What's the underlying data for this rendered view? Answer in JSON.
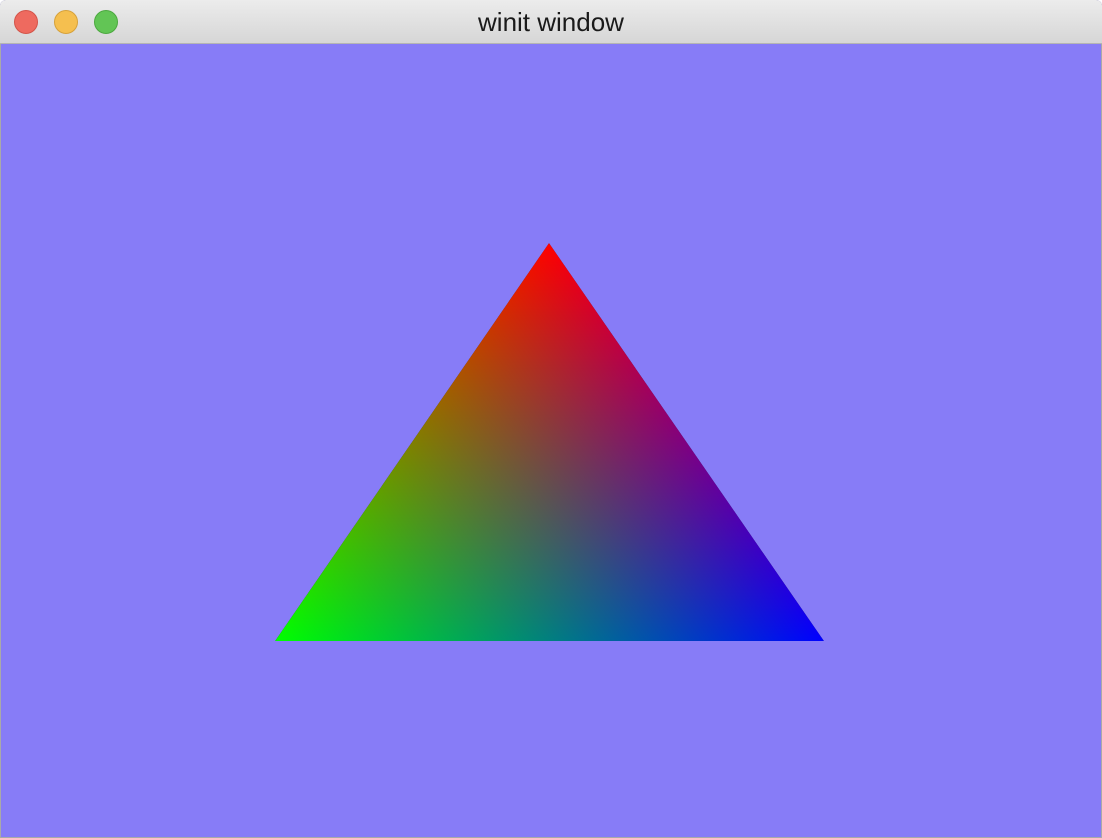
{
  "window": {
    "title": "winit window",
    "background_color": "#877cf7"
  },
  "titlebar": {
    "buttons": [
      {
        "name": "close-button",
        "icon": "close-icon",
        "color": "#ee6a5f",
        "border": "#d35449"
      },
      {
        "name": "minimize-button",
        "icon": "minimize-icon",
        "color": "#f5bf4f",
        "border": "#d6a13a"
      },
      {
        "name": "maximize-button",
        "icon": "maximize-icon",
        "color": "#62c555",
        "border": "#4ca83f"
      }
    ]
  },
  "scene": {
    "shape": "triangle",
    "vertex_colors": {
      "top": "#ff0000",
      "bottom_left": "#00ff00",
      "bottom_right": "#0000ff"
    }
  }
}
